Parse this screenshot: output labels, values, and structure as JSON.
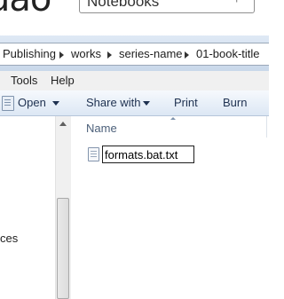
{
  "window": {
    "title_fragment": "uao",
    "tab_title": "Notebooks",
    "tab_new_glyph": "+"
  },
  "breadcrumb": {
    "items": [
      "Publishing",
      "works",
      "series-name",
      "01-book-title"
    ]
  },
  "menu": {
    "items": [
      "Tools",
      "Help"
    ]
  },
  "toolbar": {
    "open_label": "Open",
    "share_label": "Share with",
    "print_label": "Print",
    "burn_label": "Burn"
  },
  "nav_pane": {
    "partial_item": "ces"
  },
  "file_list": {
    "column_name": "Name",
    "rename_value": "formats.bat.txt"
  },
  "icons": {
    "open": "document-icon",
    "file": "text-file-icon"
  }
}
